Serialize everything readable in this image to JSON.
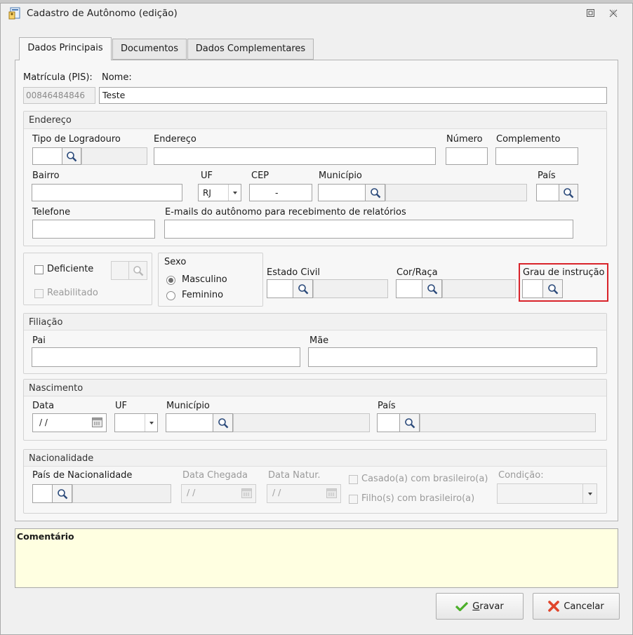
{
  "window": {
    "title": "Cadastro de Autônomo (edição)"
  },
  "tabs": [
    {
      "label": "Dados Principais",
      "active": true
    },
    {
      "label": "Documentos",
      "active": false
    },
    {
      "label": "Dados Complementares",
      "active": false
    }
  ],
  "header": {
    "matricula_label": "Matrícula (PIS):",
    "matricula_value": "00846484846",
    "nome_label": "Nome:",
    "nome_value": "Teste"
  },
  "endereco": {
    "title": "Endereço",
    "tipo_logradouro_label": "Tipo de Logradouro",
    "endereco_label": "Endereço",
    "numero_label": "Número",
    "complemento_label": "Complemento",
    "bairro_label": "Bairro",
    "uf_label": "UF",
    "uf_value": "RJ",
    "cep_label": "CEP",
    "cep_value": "-",
    "municipio_label": "Município",
    "pais_label": "País",
    "telefone_label": "Telefone",
    "emails_label": "E-mails do autônomo para recebimento de relatórios"
  },
  "pessoal": {
    "deficiente_label": "Deficiente",
    "reabilitado_label": "Reabilitado",
    "sexo_title": "Sexo",
    "masculino_label": "Masculino",
    "feminino_label": "Feminino",
    "selected_sexo": "Masculino",
    "estado_civil_label": "Estado Civil",
    "cor_raca_label": "Cor/Raça",
    "grau_instrucao_label": "Grau de instrução"
  },
  "filiacao": {
    "title": "Filiação",
    "pai_label": "Pai",
    "mae_label": "Mãe"
  },
  "nascimento": {
    "title": "Nascimento",
    "data_label": "Data",
    "data_value": "/ /",
    "uf_label": "UF",
    "municipio_label": "Município",
    "pais_label": "País"
  },
  "nacionalidade": {
    "title": "Nacionalidade",
    "pais_label": "País de Nacionalidade",
    "data_chegada_label": "Data Chegada",
    "data_chegada_value": "/ /",
    "data_natur_label": "Data Natur.",
    "data_natur_value": "/ /",
    "casado_label": "Casado(a) com brasileiro(a)",
    "filhos_label": "Filho(s) com brasileiro(a)",
    "condicao_label": "Condição:"
  },
  "comment": {
    "label": "Comentário"
  },
  "footer": {
    "gravar_prefix": "",
    "gravar_accel": "G",
    "gravar_rest": "ravar",
    "cancelar_label": "Cancelar"
  },
  "colors": {
    "highlight": "#d9232a",
    "comment_bg": "#ffffe1",
    "check_green": "#4caf2a",
    "cancel_red": "#e0452b"
  }
}
